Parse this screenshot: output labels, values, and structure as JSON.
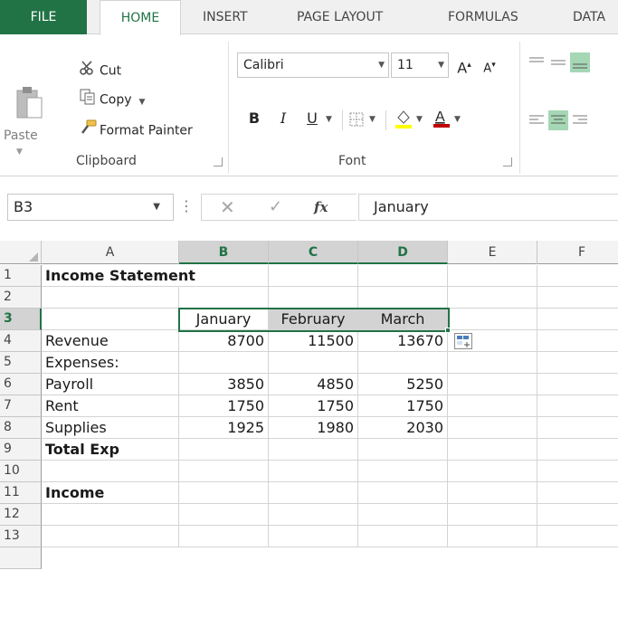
{
  "ribbon": {
    "tabs": [
      "FILE",
      "HOME",
      "INSERT",
      "PAGE LAYOUT",
      "FORMULAS",
      "DATA"
    ],
    "active_tab": "HOME",
    "clipboard": {
      "paste": "Paste",
      "cut": "Cut",
      "copy": "Copy",
      "format_painter": "Format Painter",
      "group_label": "Clipboard"
    },
    "font": {
      "font_name": "Calibri",
      "font_size": "11",
      "bold": "B",
      "italic": "I",
      "underline": "U",
      "group_label": "Font"
    }
  },
  "formula_bar": {
    "name_box": "B3",
    "cancel": "✕",
    "enter": "✓",
    "fx": "fx",
    "content": "January"
  },
  "sheet": {
    "columns": [
      "A",
      "B",
      "C",
      "D",
      "E",
      "F"
    ],
    "selected_columns": [
      "B",
      "C",
      "D"
    ],
    "rows": [
      "1",
      "2",
      "3",
      "4",
      "5",
      "6",
      "7",
      "8",
      "9",
      "10",
      "11",
      "12",
      "13"
    ],
    "selected_row": "3",
    "title": "Income Statement",
    "months": [
      "January",
      "February",
      "March"
    ],
    "revenue": {
      "label": "Revenue",
      "values": [
        "8700",
        "11500",
        "13670"
      ]
    },
    "expenses_label": "Expenses:",
    "payroll": {
      "label": "Payroll",
      "values": [
        "3850",
        "4850",
        "5250"
      ]
    },
    "rent": {
      "label": "Rent",
      "values": [
        "1750",
        "1750",
        "1750"
      ]
    },
    "supplies": {
      "label": "Supplies",
      "values": [
        "1925",
        "1980",
        "2030"
      ]
    },
    "total_exp": "Total Exp",
    "income": "Income"
  },
  "colors": {
    "accent": "#217346",
    "selection_fill": "#d3d3d3",
    "active_align": "#a5d7b5"
  }
}
